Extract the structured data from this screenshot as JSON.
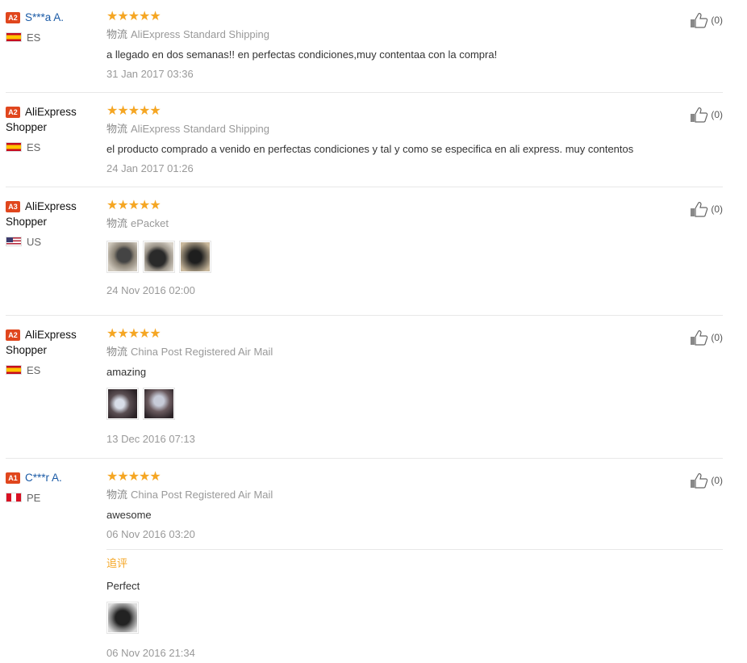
{
  "reviews": [
    {
      "level": "A2",
      "level_color": "#e0461d",
      "user": "S***a A.",
      "country": "ES",
      "stars": "★★★★★",
      "shipping_label": "物流",
      "shipping": "AliExpress Standard Shipping",
      "text": "a llegado en dos semanas!! en perfectas condiciones,muy contentaa con la compra!",
      "date": "31 Jan 2017 03:36",
      "likes": "(0)"
    },
    {
      "level": "A2",
      "level_color": "#e0461d",
      "user": "AliExpress Shopper",
      "country": "ES",
      "stars": "★★★★★",
      "shipping_label": "物流",
      "shipping": "AliExpress Standard Shipping",
      "text": "el producto comprado a venido en perfectas condiciones y tal y como se especifica en ali express. muy contentos",
      "date": "24 Jan 2017 01:26",
      "likes": "(0)"
    },
    {
      "level": "A3",
      "level_color": "#e0461d",
      "user": "AliExpress Shopper",
      "country": "US",
      "stars": "★★★★★",
      "shipping_label": "物流",
      "shipping": "ePacket",
      "photos": [
        "photo-1",
        "photo-2",
        "photo-3"
      ],
      "date": "24 Nov 2016 02:00",
      "likes": "(0)"
    },
    {
      "level": "A2",
      "level_color": "#e0461d",
      "user": "AliExpress Shopper",
      "country": "ES",
      "stars": "★★★★★",
      "shipping_label": "物流",
      "shipping": "China Post Registered Air Mail",
      "text": "amazing",
      "photos": [
        "photo-1",
        "photo-2"
      ],
      "date": "13 Dec 2016 07:13",
      "likes": "(0)"
    },
    {
      "level": "A1",
      "level_color": "#e0461d",
      "user": "C***r A.",
      "country": "PE",
      "stars": "★★★★★",
      "shipping_label": "物流",
      "shipping": "China Post Registered Air Mail",
      "text": "awesome",
      "date": "06 Nov 2016 03:20",
      "likes": "(0)",
      "followup": {
        "title": "追评",
        "text": "Perfect",
        "photos": [
          "photo-1"
        ],
        "date": "06 Nov 2016 21:34"
      }
    }
  ],
  "colors": {
    "star": "#f5a623",
    "link": "#1a5aa6",
    "badge": "#e0461d",
    "followup": "#f5a623"
  }
}
